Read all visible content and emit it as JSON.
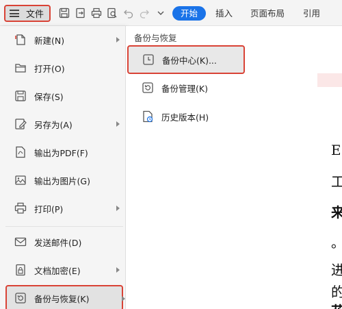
{
  "toolbar": {
    "file_label": "文件",
    "tabs": [
      {
        "label": "开始",
        "active": true
      },
      {
        "label": "插入",
        "active": false
      },
      {
        "label": "页面布局",
        "active": false
      },
      {
        "label": "引用",
        "active": false
      }
    ],
    "accent_color": "#1a73e8",
    "highlight_color": "#d94235"
  },
  "menu": {
    "items": [
      {
        "label": "新建(N)",
        "icon": "new-file-icon",
        "has_submenu": true
      },
      {
        "label": "打开(O)",
        "icon": "folder-open-icon",
        "has_submenu": false
      },
      {
        "label": "保存(S)",
        "icon": "save-icon",
        "has_submenu": false
      },
      {
        "label": "另存为(A)",
        "icon": "save-as-icon",
        "has_submenu": true
      },
      {
        "label": "输出为PDF(F)",
        "icon": "pdf-export-icon",
        "has_submenu": false
      },
      {
        "label": "输出为图片(G)",
        "icon": "image-export-icon",
        "has_submenu": false
      },
      {
        "label": "打印(P)",
        "icon": "printer-icon",
        "has_submenu": true
      },
      {
        "label": "发送邮件(D)",
        "icon": "mail-icon",
        "has_submenu": false
      },
      {
        "label": "文档加密(E)",
        "icon": "lock-icon",
        "has_submenu": true
      },
      {
        "label": "备份与恢复(K)",
        "icon": "backup-icon",
        "has_submenu": true,
        "selected": true
      }
    ]
  },
  "submenu": {
    "title": "备份与恢复",
    "items": [
      {
        "label": "备份中心(K)...",
        "icon": "backup-center-icon",
        "selected": true
      },
      {
        "label": "备份管理(K)",
        "icon": "backup-manage-icon",
        "selected": false
      },
      {
        "label": "历史版本(H)",
        "icon": "history-version-icon",
        "selected": false
      }
    ]
  },
  "document": {
    "visible_fragments": [
      "E国",
      "工作",
      "来",
      "。",
      "进",
      "的",
      "花"
    ]
  }
}
